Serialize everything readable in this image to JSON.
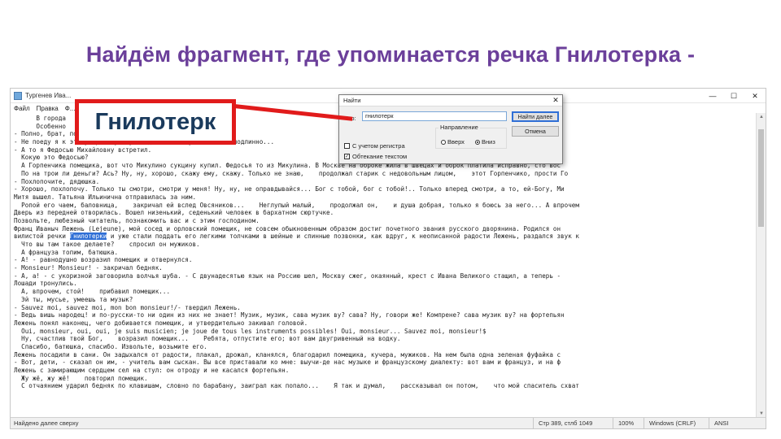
{
  "slide": {
    "title": "Найдём фрагмент, где упоминается речка Гнилотерка -",
    "callout": "Гнилотерк"
  },
  "notepad": {
    "title": "Тургенев Ива...",
    "menu": [
      "Файл",
      "Правка",
      "Ф..."
    ],
    "window_buttons": [
      "—",
      "☐",
      "✕"
    ],
    "lines": [
      {
        "text": "      В города"
      },
      {
        "text": "      Особенно                  ал, по гитаре бренча...                                            ремнатках просьбы сошлись, с купецкими сы"
      },
      {
        "text": "- Полно, брат, полно...    ал Мита. - Ах, да...                                                    к себе вас в воскресенье просит откушать"
      },
      {
        "text": "- Не поеду я к этому брюхачу. Лучше даст сотенную, а масло подлинно..."
      },
      {
        "text": "- А то я Федосью Михайловну встретил."
      },
      {
        "text": "  Кокую это Федосью?"
      },
      {
        "text": "  А Горпенчика помещика, вот что Микулино сукцину купил. Федосья то из Микулина. В Москве на оброке жила в швецах и оброк платила исправно, сто вос"
      },
      {
        "text": "  По на трои ли деньги? Ась? Ну, ну, хорошо, скажу ему, скажу. Только не знаю,    продолжал старик с недовольным лицом,    этот Горпенчико, прости Го"
      },
      {
        "text": "- Похлопочите, дядюшка."
      },
      {
        "text": "- Хорошо, похлопочу. Только ты смотри, смотри у меня! Ну, ну, не оправдывайся... Бог с тобой, бог с тобой!.. Только вперед смотри, а то, ей-Богу, Ми"
      },
      {
        "text": "Митя вышел. Татьяна Ильинична отправилась за ним."
      },
      {
        "text": "  Ропой его чаем, баловница,    закричал ей вслед Овсяников...    Неглупый малый,    продолжал он,    и душа добрая, только я боюсь за него... А впрочем"
      },
      {
        "text": "Дверь из передней отворилась. Вошел низенький, седенький человек в бархатном сюртучке."
      },
      {
        "text": "Позвольте, любезный читатель, познакомить вас и с этим господином."
      },
      {
        "text": "Франц Иваныч Лежень (Lejeune), мой сосед и орловский помещик, не совсем обыкновенным образом достиг почетного звания русского дворянина. Родился он"
      },
      {
        "text": "вилистой речки ",
        "hl": "Гнилотерки",
        "after": " и уже стали поддать его легкими толчками в шейные и спинные позвонки, как вдруг, к неописанной радости Лежень, раздался звук к"
      },
      {
        "text": "  Что вы там такое делаете?    спросил он мужиков."
      },
      {
        "text": "  А француза топим, батюшка."
      },
      {
        "text": "- А! - равнодушно возразил помещик и отвернулся."
      },
      {
        "text": "- Monsieur! Monsieur! - закричал бедняк."
      },
      {
        "text": "- А, а! - с укоризной заговорила волчья шуба. - С двунадесятью язык на Россию шел, Москву сжег, окаянный, крест с Ивана Великого стащил, а теперь -"
      },
      {
        "text": "Лошади тронулись."
      },
      {
        "text": "  А, впрочем, стой!    прибавил помещик..."
      },
      {
        "text": "  Эй ты, мусье, умеешь та музык?"
      },
      {
        "text": "- Sauvez moi, sauvez moi, mon bon monsieur!/- твердил Лежень."
      },
      {
        "text": "- Ведь вишь народец! и по-русски-то ни один из них не знает! Музик, музик, сава музик ву? сава? Ну, говори же! Компрене? сава музик ву? на фортепьян"
      },
      {
        "text": "Лежень понял наконец, чего добивается помещик, и утвердительно закивал головой."
      },
      {
        "text": "  Oui, monsieur, oui, oui, je suis musicien; je joue de tous les instruments possibles! Oui, monsieur... Sauvez moi, monsieur!$"
      },
      {
        "text": "  Ну, счастлив твой Бог,    возразил помещик...    Ребята, отпустите его; вот вам двугривенный на водку."
      },
      {
        "text": "  Спасибо, батюшка, спасибо. Извольте, возьмите его."
      },
      {
        "text": "Лежень посадили в сани. Он задыхался от радости, плакал, дрожал, кланялся, благодарил помещика, кучера, мужиков. На нем была одна зеленая фуфайка с"
      },
      {
        "text": "- Вот, дети, - сказал он им, - учитель вам сыскан. Вы все приставали ко мне: выучи-де нас музыке и французскому диалекту: вот вам и француз, и на ф"
      },
      {
        "text": "Лежень с замирающим сердцем сел на стул: он отроду и не касался фортепьян."
      },
      {
        "text": "  Жу жё, жу жё!    повторил помещик."
      },
      {
        "text": "  С отчаянием ударил бедняк по клавишам, словно по барабану, заиграл как попало...    Я так и думал,    рассказывал он потом,    что мой спаситель схват"
      }
    ],
    "status": {
      "left": "Найдено далее сверху",
      "position": "Стр 389, стлб 1049",
      "zoom": "100%",
      "eol": "Windows (CRLF)",
      "encoding": "ANSI"
    }
  },
  "find_dialog": {
    "title": "Найти",
    "find_label": "Что:",
    "find_value": "гнилотерк",
    "find_next_label": "Найти далее",
    "cancel_label": "Отмена",
    "direction_label": "Направление",
    "up_label": "Вверх",
    "down_label": "Вниз",
    "direction_selected": "down",
    "match_case_label": "С учетом регистра",
    "wrap_label": "Обтекание текстом",
    "match_case_checked": false,
    "wrap_checked": true
  },
  "colors": {
    "title": "#6b3f9a",
    "callout_border": "#e11b1b",
    "callout_text": "#1a3a5c",
    "highlight": "#2f6fd6"
  }
}
